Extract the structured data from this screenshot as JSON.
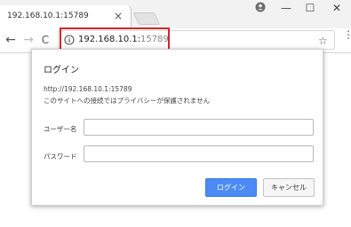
{
  "tab": {
    "title": "192.168.10.1:15789",
    "close_glyph": "×"
  },
  "window_controls": {
    "minimize": "—",
    "maximize": "☐",
    "close": "✕"
  },
  "toolbar": {
    "back": "←",
    "forward": "→",
    "reload": "C",
    "url_host": "192.168.10.1:",
    "url_port": "15789",
    "star": "☆",
    "menu": "⋮"
  },
  "dialog": {
    "title": "ログイン",
    "url": "http://192.168.10.1:15789",
    "warning": "このサイトへの接続ではプライバシーが保護されません",
    "username_label": "ユーザー名",
    "password_label": "パスワード",
    "login_button": "ログイン",
    "cancel_button": "キャンセル"
  },
  "colors": {
    "highlight": "#d8232a",
    "primary_button": "#4c8bf5"
  }
}
